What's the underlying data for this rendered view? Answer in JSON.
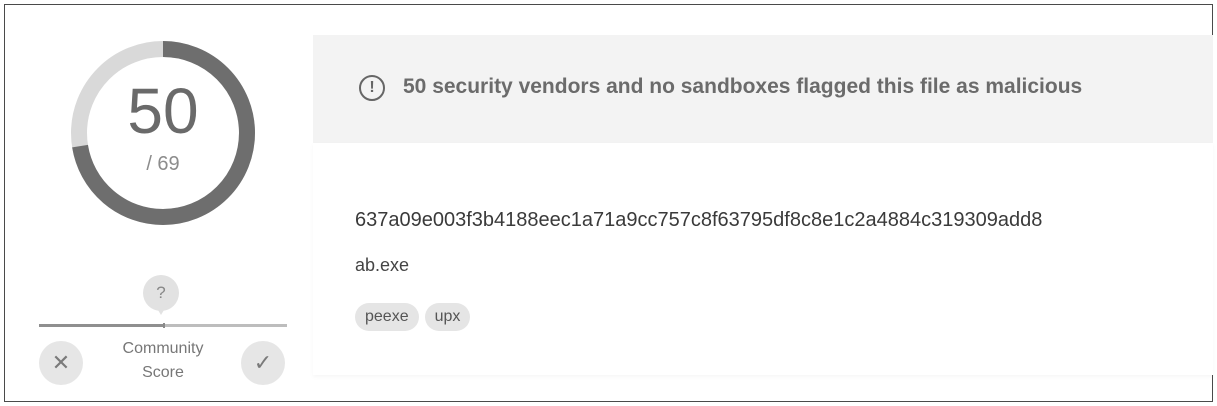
{
  "detection": {
    "positives": "50",
    "total": "/ 69",
    "ratio": 0.7246
  },
  "community": {
    "unknown_label": "?",
    "label_line1": "Community",
    "label_line2": "Score",
    "down_symbol": "✕",
    "up_symbol": "✓"
  },
  "banner": {
    "icon_symbol": "!",
    "text": "50 security vendors and no sandboxes flagged this file as malicious"
  },
  "file": {
    "hash": "637a09e003f3b4188eec1a71a9cc757c8f63795df8c8e1c2a4884c319309add8",
    "name": "ab.exe",
    "tags": [
      "peexe",
      "upx"
    ]
  },
  "colors": {
    "gauge_fill": "#6e6e6e",
    "gauge_track": "#d9d9d9",
    "banner_bg": "#f3f3f3"
  },
  "icons": {
    "alert": "exclamation-circle-icon",
    "question": "question-pin-icon",
    "downvote": "close-icon",
    "upvote": "check-icon"
  }
}
